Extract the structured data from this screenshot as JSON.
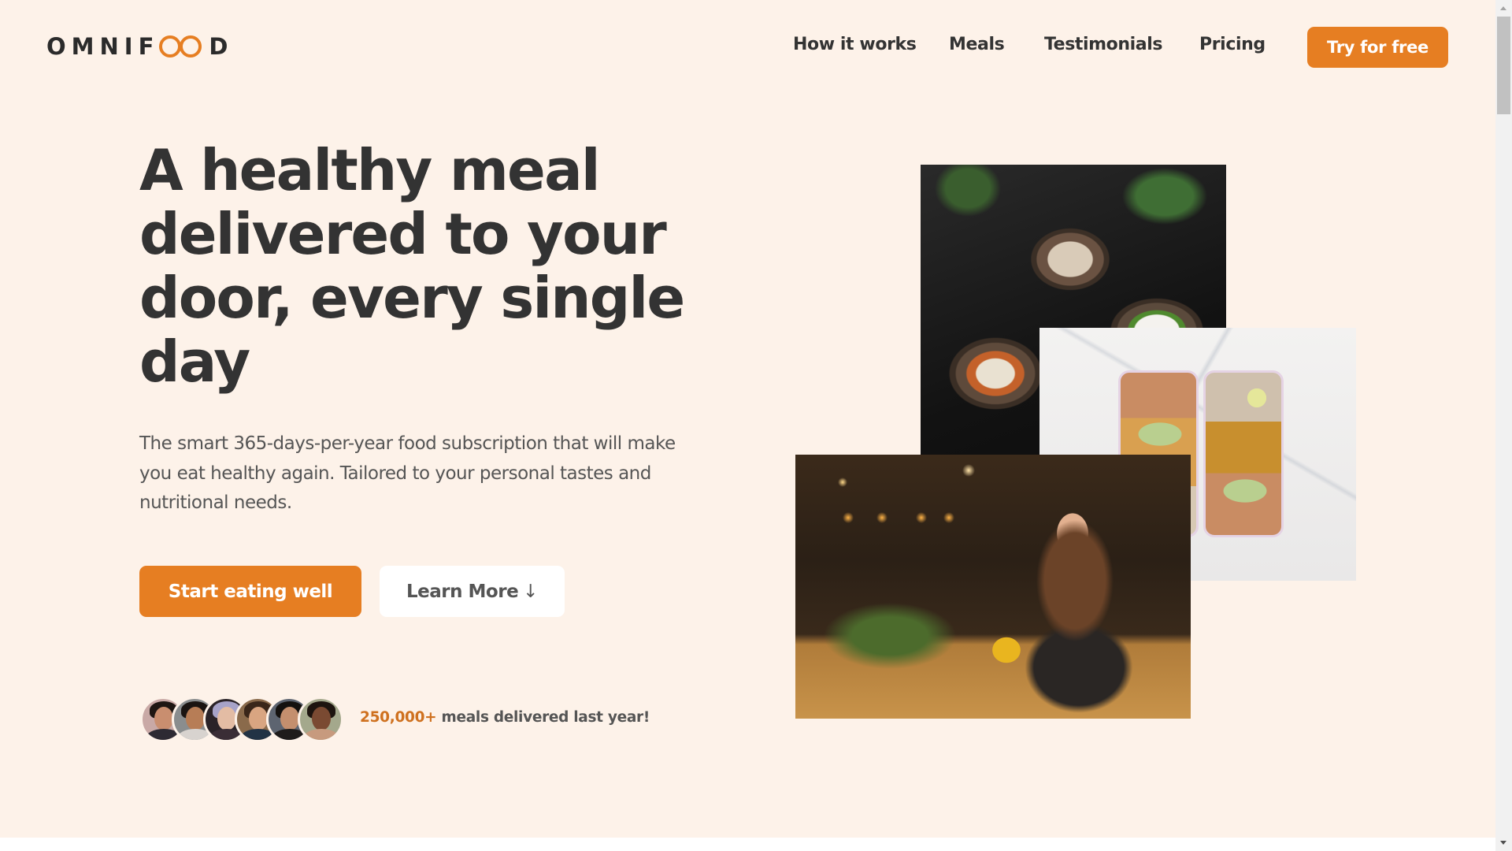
{
  "brand": {
    "name_prefix": "OMNIF",
    "name_suffix": "D",
    "logo_icon": "infinity-oo-icon",
    "accent_color": "#e67e22",
    "accent_dark": "#cf711f",
    "background_color": "#fdf2e9"
  },
  "nav": {
    "items": [
      {
        "label": "How it works"
      },
      {
        "label": "Meals"
      },
      {
        "label": "Testimonials"
      },
      {
        "label": "Pricing"
      }
    ],
    "cta_label": "Try for free"
  },
  "hero": {
    "title": "A healthy meal delivered to your door, every single day",
    "description": "The smart 365-days-per-year food subscription that will make you eat healthy again. Tailored to your personal tastes and nutritional needs.",
    "primary_button": "Start eating well",
    "secondary_button": "Learn More",
    "secondary_button_icon": "↓",
    "delivered": {
      "count": "250,000+",
      "text": " meals delivered last year!",
      "customer_count_shown": 6
    },
    "images": [
      {
        "name": "bowls-of-food-photo",
        "alt": "Bowls of rice, meat and vegetables"
      },
      {
        "name": "lunchbox-meal-photo",
        "alt": "Lunchbox with chickpeas, avocado and curry"
      },
      {
        "name": "woman-eating-photo",
        "alt": "Woman enjoying a meal in a cafe"
      }
    ]
  }
}
